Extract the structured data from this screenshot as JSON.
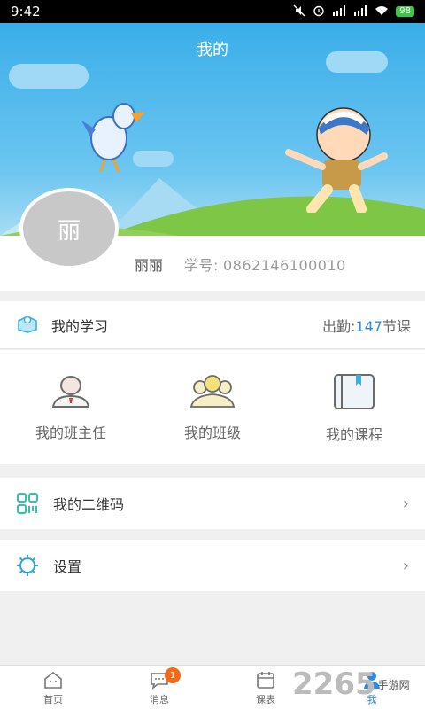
{
  "statusbar": {
    "time": "9:42",
    "battery": "98"
  },
  "header": {
    "title": "我的"
  },
  "profile": {
    "avatar_char": "丽",
    "name": "丽丽",
    "sid_label": "学号:",
    "sid_value": "0862146100010"
  },
  "study": {
    "title": "我的学习",
    "attendance_label": "出勤:",
    "attendance_count": "147",
    "attendance_unit": "节课"
  },
  "grid": [
    {
      "label": "我的班主任"
    },
    {
      "label": "我的班级"
    },
    {
      "label": "我的课程"
    }
  ],
  "rows": {
    "qrcode": "我的二维码",
    "settings": "设置"
  },
  "tabs": [
    {
      "label": "首页"
    },
    {
      "label": "消息",
      "badge": "1"
    },
    {
      "label": "课表"
    },
    {
      "label": "我"
    }
  ],
  "watermark": {
    "brand": "2265",
    "site": "手游网"
  },
  "colors": {
    "accent": "#2a8be0",
    "badge": "#f26a1b",
    "sky": "#3aaee9"
  }
}
